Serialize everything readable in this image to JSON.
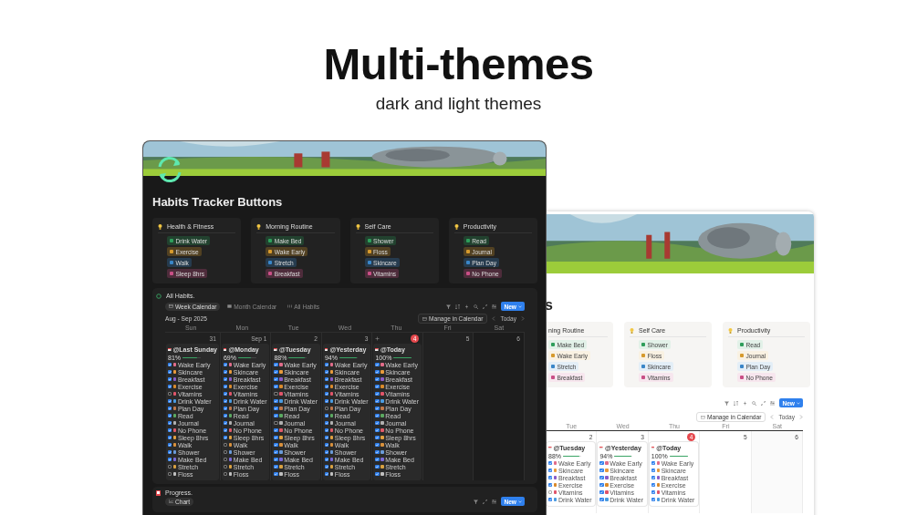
{
  "hero": {
    "title": "Multi-themes",
    "subtitle": "dark and light themes"
  },
  "dark_window": {
    "title": "Habits Tracker Buttons",
    "groups": [
      {
        "title": "Health & Fitness",
        "buttons": [
          {
            "label": "Drink Water",
            "color": "#2e9e5b"
          },
          {
            "label": "Exercise",
            "color": "#d69a2d"
          },
          {
            "label": "Walk",
            "color": "#3a86c8"
          },
          {
            "label": "Sleep 8hrs",
            "color": "#c94f86"
          }
        ]
      },
      {
        "title": "Morning Routine",
        "buttons": [
          {
            "label": "Make Bed",
            "color": "#2e9e5b"
          },
          {
            "label": "Wake Early",
            "color": "#d69a2d"
          },
          {
            "label": "Stretch",
            "color": "#3a86c8"
          },
          {
            "label": "Breakfast",
            "color": "#c94f86"
          }
        ]
      },
      {
        "title": "Self Care",
        "buttons": [
          {
            "label": "Shower",
            "color": "#2e9e5b"
          },
          {
            "label": "Floss",
            "color": "#d69a2d"
          },
          {
            "label": "Skincare",
            "color": "#3a86c8"
          },
          {
            "label": "Vitamins",
            "color": "#c94f86"
          }
        ]
      },
      {
        "title": "Productivity",
        "buttons": [
          {
            "label": "Read",
            "color": "#2e9e5b"
          },
          {
            "label": "Journal",
            "color": "#d69a2d"
          },
          {
            "label": "Plan Day",
            "color": "#3a86c8"
          },
          {
            "label": "No Phone",
            "color": "#c94f86"
          }
        ]
      }
    ],
    "habits_view": {
      "title": "All Habits.",
      "tabs": [
        {
          "label": "Week Calendar",
          "selected": true
        },
        {
          "label": "Month Calendar",
          "selected": false
        },
        {
          "label": "All Habits",
          "selected": false
        }
      ],
      "new_button": "New",
      "range": "Aug - Sep 2025",
      "manage_button": "Manage in Calendar",
      "today_button": "Today",
      "weekdays": [
        "Sun",
        "Mon",
        "Tue",
        "Wed",
        "Thu",
        "Fri",
        "Sat"
      ],
      "days": [
        {
          "number": "31",
          "today": false,
          "card": {
            "title": "@Last Sunday",
            "percent": "81%",
            "level": 0.81,
            "habits": [
              {
                "label": "Wake Early",
                "checked": true
              },
              {
                "label": "Skincare",
                "checked": true
              },
              {
                "label": "Breakfast",
                "checked": true
              },
              {
                "label": "Exercise",
                "checked": true
              },
              {
                "label": "Vitamins",
                "checked": false
              },
              {
                "label": "Drink Water",
                "checked": true
              },
              {
                "label": "Plan Day",
                "checked": true
              },
              {
                "label": "Read",
                "checked": true
              },
              {
                "label": "Journal",
                "checked": true
              },
              {
                "label": "No Phone",
                "checked": true
              },
              {
                "label": "Sleep 8hrs",
                "checked": true
              },
              {
                "label": "Walk",
                "checked": true
              },
              {
                "label": "Shower",
                "checked": true
              },
              {
                "label": "Make Bed",
                "checked": true
              },
              {
                "label": "Stretch",
                "checked": false
              },
              {
                "label": "Floss",
                "checked": false
              }
            ]
          }
        },
        {
          "number": "Sep 1",
          "today": false,
          "card": {
            "title": "@Monday",
            "percent": "69%",
            "level": 0.69,
            "habits": [
              {
                "label": "Wake Early",
                "checked": true
              },
              {
                "label": "Skincare",
                "checked": true
              },
              {
                "label": "Breakfast",
                "checked": true
              },
              {
                "label": "Exercise",
                "checked": true
              },
              {
                "label": "Vitamins",
                "checked": true
              },
              {
                "label": "Drink Water",
                "checked": true
              },
              {
                "label": "Plan Day",
                "checked": true
              },
              {
                "label": "Read",
                "checked": true
              },
              {
                "label": "Journal",
                "checked": true
              },
              {
                "label": "No Phone",
                "checked": true
              },
              {
                "label": "Sleep 8hrs",
                "checked": true
              },
              {
                "label": "Walk",
                "checked": false
              },
              {
                "label": "Shower",
                "checked": false
              },
              {
                "label": "Make Bed",
                "checked": false
              },
              {
                "label": "Stretch",
                "checked": false
              },
              {
                "label": "Floss",
                "checked": false
              }
            ]
          }
        },
        {
          "number": "2",
          "today": false,
          "card": {
            "title": "@Tuesday",
            "percent": "88%",
            "level": 0.88,
            "habits": [
              {
                "label": "Wake Early",
                "checked": true
              },
              {
                "label": "Skincare",
                "checked": true
              },
              {
                "label": "Breakfast",
                "checked": true
              },
              {
                "label": "Exercise",
                "checked": true
              },
              {
                "label": "Vitamins",
                "checked": false
              },
              {
                "label": "Drink Water",
                "checked": true
              },
              {
                "label": "Plan Day",
                "checked": true
              },
              {
                "label": "Read",
                "checked": true
              },
              {
                "label": "Journal",
                "checked": false
              },
              {
                "label": "No Phone",
                "checked": true
              },
              {
                "label": "Sleep 8hrs",
                "checked": true
              },
              {
                "label": "Walk",
                "checked": true
              },
              {
                "label": "Shower",
                "checked": true
              },
              {
                "label": "Make Bed",
                "checked": true
              },
              {
                "label": "Stretch",
                "checked": true
              },
              {
                "label": "Floss",
                "checked": true
              }
            ]
          }
        },
        {
          "number": "3",
          "today": false,
          "card": {
            "title": "@Yesterday",
            "percent": "94%",
            "level": 0.94,
            "habits": [
              {
                "label": "Wake Early",
                "checked": true
              },
              {
                "label": "Skincare",
                "checked": true
              },
              {
                "label": "Breakfast",
                "checked": true
              },
              {
                "label": "Exercise",
                "checked": true
              },
              {
                "label": "Vitamins",
                "checked": true
              },
              {
                "label": "Drink Water",
                "checked": true
              },
              {
                "label": "Plan Day",
                "checked": false
              },
              {
                "label": "Read",
                "checked": true
              },
              {
                "label": "Journal",
                "checked": true
              },
              {
                "label": "No Phone",
                "checked": true
              },
              {
                "label": "Sleep 8hrs",
                "checked": true
              },
              {
                "label": "Walk",
                "checked": true
              },
              {
                "label": "Shower",
                "checked": true
              },
              {
                "label": "Make Bed",
                "checked": true
              },
              {
                "label": "Stretch",
                "checked": true
              },
              {
                "label": "Floss",
                "checked": true
              }
            ]
          }
        },
        {
          "number": "4",
          "today": true,
          "card": {
            "title": "@Today",
            "percent": "100%",
            "level": 1,
            "habits": [
              {
                "label": "Wake Early",
                "checked": true
              },
              {
                "label": "Skincare",
                "checked": true
              },
              {
                "label": "Breakfast",
                "checked": true
              },
              {
                "label": "Exercise",
                "checked": true
              },
              {
                "label": "Vitamins",
                "checked": true
              },
              {
                "label": "Drink Water",
                "checked": true
              },
              {
                "label": "Plan Day",
                "checked": true
              },
              {
                "label": "Read",
                "checked": true
              },
              {
                "label": "Journal",
                "checked": true
              },
              {
                "label": "No Phone",
                "checked": true
              },
              {
                "label": "Sleep 8hrs",
                "checked": true
              },
              {
                "label": "Walk",
                "checked": true
              },
              {
                "label": "Shower",
                "checked": true
              },
              {
                "label": "Make Bed",
                "checked": true
              },
              {
                "label": "Stretch",
                "checked": true
              },
              {
                "label": "Floss",
                "checked": true
              }
            ]
          }
        },
        {
          "number": "5",
          "today": false
        },
        {
          "number": "6",
          "today": false
        }
      ]
    },
    "progress": {
      "title": "Progress.",
      "tabs": [
        {
          "label": "Chart",
          "selected": true
        }
      ],
      "new_button": "New"
    }
  },
  "light_window": {
    "title": "s",
    "groups": [
      {
        "title": "ning Routine",
        "buttons": [
          {
            "label": "Make Bed",
            "color": "#2e9e5b"
          },
          {
            "label": "Wake Early",
            "color": "#d69a2d"
          },
          {
            "label": "Stretch",
            "color": "#3a86c8"
          },
          {
            "label": "Breakfast",
            "color": "#c94f86"
          }
        ]
      },
      {
        "title": "Self Care",
        "buttons": [
          {
            "label": "Shower",
            "color": "#2e9e5b"
          },
          {
            "label": "Floss",
            "color": "#d69a2d"
          },
          {
            "label": "Skincare",
            "color": "#3a86c8"
          },
          {
            "label": "Vitamins",
            "color": "#c94f86"
          }
        ]
      },
      {
        "title": "Productivity",
        "buttons": [
          {
            "label": "Read",
            "color": "#2e9e5b"
          },
          {
            "label": "Journal",
            "color": "#d69a2d"
          },
          {
            "label": "Plan Day",
            "color": "#3a86c8"
          },
          {
            "label": "No Phone",
            "color": "#c94f86"
          }
        ]
      }
    ],
    "calendar": {
      "new_button": "New",
      "manage_button": "Manage in Calendar",
      "today_button": "Today",
      "weekdays": [
        "Tue",
        "Wed",
        "Thu",
        "Fri",
        "Sat"
      ],
      "days": [
        {
          "number": "2",
          "today": false,
          "card": {
            "title": "@Tuesday",
            "percent": "88%",
            "level": 0.88,
            "habits": [
              {
                "label": "Wake Early",
                "checked": true
              },
              {
                "label": "Skincare",
                "checked": true
              },
              {
                "label": "Breakfast",
                "checked": true
              },
              {
                "label": "Exercise",
                "checked": true
              },
              {
                "label": "Vitamins",
                "checked": false
              },
              {
                "label": "Drink Water",
                "checked": true
              }
            ]
          }
        },
        {
          "number": "3",
          "today": false,
          "card": {
            "title": "@Yesterday",
            "percent": "94%",
            "level": 0.94,
            "habits": [
              {
                "label": "Wake Early",
                "checked": true
              },
              {
                "label": "Skincare",
                "checked": true
              },
              {
                "label": "Breakfast",
                "checked": true
              },
              {
                "label": "Exercise",
                "checked": true
              },
              {
                "label": "Vitamins",
                "checked": true
              },
              {
                "label": "Drink Water",
                "checked": true
              }
            ]
          }
        },
        {
          "number": "4",
          "today": true,
          "card": {
            "title": "@Today",
            "percent": "100%",
            "level": 1,
            "habits": [
              {
                "label": "Wake Early",
                "checked": true
              },
              {
                "label": "Skincare",
                "checked": true
              },
              {
                "label": "Breakfast",
                "checked": true
              },
              {
                "label": "Exercise",
                "checked": true
              },
              {
                "label": "Vitamins",
                "checked": true
              },
              {
                "label": "Drink Water",
                "checked": true
              }
            ]
          }
        },
        {
          "number": "5",
          "today": false
        },
        {
          "number": "6",
          "today": false
        }
      ]
    }
  }
}
